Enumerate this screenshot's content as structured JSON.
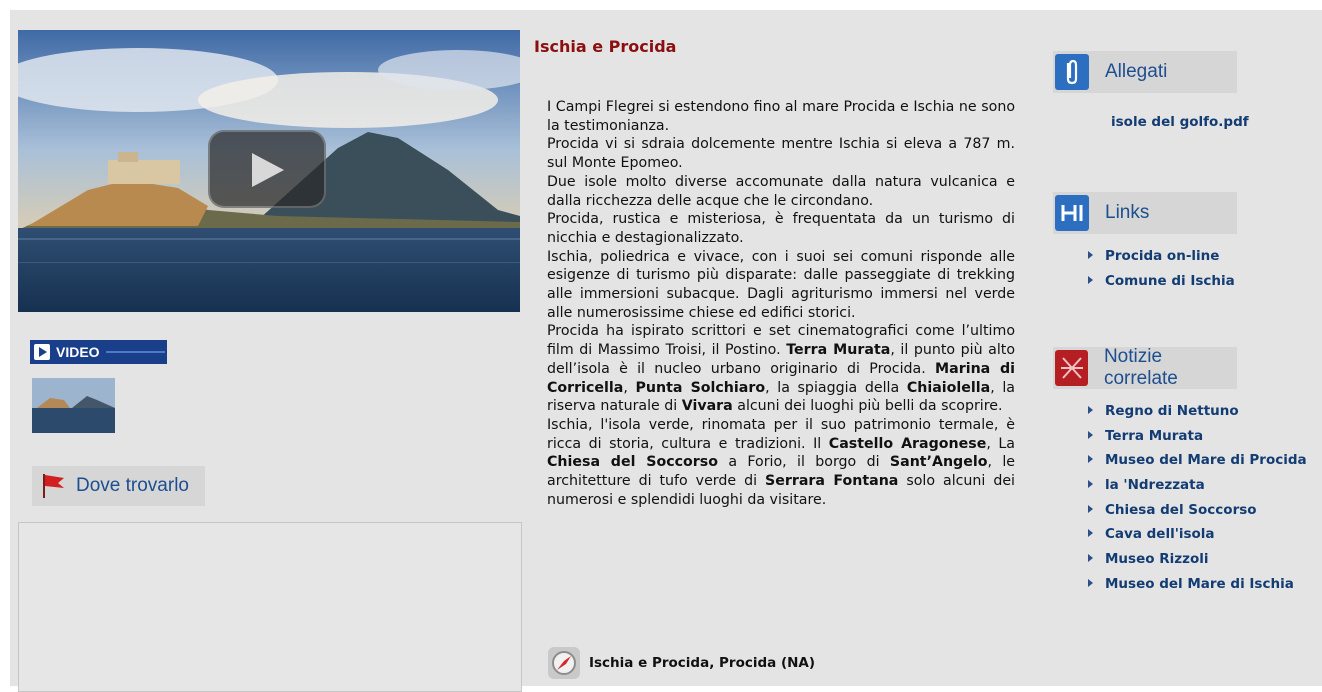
{
  "article": {
    "title": "Ischia e Procida",
    "location": "Ischia e Procida, Procida (NA)"
  },
  "video": {
    "badge_label": "VIDEO"
  },
  "map": {
    "button_label": "Dove trovarlo"
  },
  "attachments": {
    "heading": "Allegati",
    "file": "isole del golfo.pdf"
  },
  "links": {
    "heading": "Links",
    "items": [
      "Procida on-line",
      "Comune di Ischia"
    ]
  },
  "related": {
    "heading": "Notizie correlate",
    "items": [
      "Regno di Nettuno",
      "Terra Murata",
      "Museo del Mare di Procida",
      "la 'Ndrezzata",
      "Chiesa del Soccorso",
      "Cava dell'isola",
      "Museo Rizzoli",
      "Museo del Mare di Ischia"
    ]
  },
  "body": [
    [
      {
        "t": "I Campi Flegrei si estendono fino al mare Procida e Ischia ne sono la testimonianza."
      }
    ],
    [
      {
        "t": "Procida vi si sdraia dolcemente mentre Ischia si eleva a 787 m. sul Monte Epomeo."
      }
    ],
    [
      {
        "t": "Due isole molto diverse accomunate dalla natura vulcanica e dalla ricchezza delle acque che le circondano."
      }
    ],
    [
      {
        "t": "Procida, rustica e misteriosa, è frequentata da un turismo di nicchia e destagionalizzato."
      }
    ],
    [
      {
        "t": "Ischia, poliedrica e vivace, con i suoi sei comuni risponde alle esigenze di turismo più disparate: dalle passeggiate di trekking alle immersioni subacque. Dagli agriturismo immersi nel verde alle numerosissime chiese ed edifici storici."
      }
    ],
    [
      {
        "t": "Procida ha ispirato scrittori e set cinematografici come l’ultimo film di Massimo Troisi, il Postino. "
      },
      {
        "t": "Terra Murata",
        "b": true
      },
      {
        "t": ", il punto più alto dell’isola è il nucleo urbano originario di Procida. "
      },
      {
        "t": "Marina di Corricella",
        "b": true
      },
      {
        "t": ", "
      },
      {
        "t": "Punta Solchiaro",
        "b": true
      },
      {
        "t": ", la spiaggia della "
      },
      {
        "t": "Chiaiolella",
        "b": true
      },
      {
        "t": ", la riserva naturale di "
      },
      {
        "t": "Vivara",
        "b": true
      },
      {
        "t": " alcuni dei luoghi più belli da scoprire."
      }
    ],
    [
      {
        "t": "Ischia, l'isola verde, rinomata per il suo patrimonio termale, è ricca di storia, cultura e tradizioni. Il "
      },
      {
        "t": "Castello Aragonese",
        "b": true
      },
      {
        "t": ", La "
      },
      {
        "t": "Chiesa del Soccorso",
        "b": true
      },
      {
        "t": " a Forio, il borgo di "
      },
      {
        "t": "Sant’Angelo",
        "b": true
      },
      {
        "t": ", le architetture di tufo verde di "
      },
      {
        "t": "Serrara Fontana",
        "b": true
      },
      {
        "t": " solo alcuni dei numerosi e splendidi luoghi da visitare."
      }
    ]
  ]
}
